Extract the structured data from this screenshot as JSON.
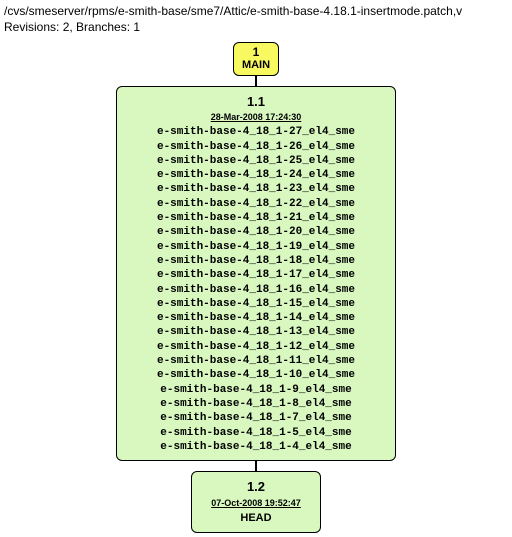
{
  "header": {
    "path": "/cvs/smeserver/rpms/e-smith-base/sme7/Attic/e-smith-base-4.18.1-insertmode.patch,v",
    "revisions_label": "Revisions: 2, Branches: 1"
  },
  "branch_node": {
    "rev": "1",
    "name": "MAIN"
  },
  "rev_1_1": {
    "number": "1.1",
    "date": "28-Mar-2008 17:24:30",
    "tags": [
      "e-smith-base-4_18_1-27_el4_sme",
      "e-smith-base-4_18_1-26_el4_sme",
      "e-smith-base-4_18_1-25_el4_sme",
      "e-smith-base-4_18_1-24_el4_sme",
      "e-smith-base-4_18_1-23_el4_sme",
      "e-smith-base-4_18_1-22_el4_sme",
      "e-smith-base-4_18_1-21_el4_sme",
      "e-smith-base-4_18_1-20_el4_sme",
      "e-smith-base-4_18_1-19_el4_sme",
      "e-smith-base-4_18_1-18_el4_sme",
      "e-smith-base-4_18_1-17_el4_sme",
      "e-smith-base-4_18_1-16_el4_sme",
      "e-smith-base-4_18_1-15_el4_sme",
      "e-smith-base-4_18_1-14_el4_sme",
      "e-smith-base-4_18_1-13_el4_sme",
      "e-smith-base-4_18_1-12_el4_sme",
      "e-smith-base-4_18_1-11_el4_sme",
      "e-smith-base-4_18_1-10_el4_sme",
      "e-smith-base-4_18_1-9_el4_sme",
      "e-smith-base-4_18_1-8_el4_sme",
      "e-smith-base-4_18_1-7_el4_sme",
      "e-smith-base-4_18_1-5_el4_sme",
      "e-smith-base-4_18_1-4_el4_sme"
    ]
  },
  "rev_1_2": {
    "number": "1.2",
    "date": "07-Oct-2008 19:52:47",
    "head": "HEAD"
  }
}
